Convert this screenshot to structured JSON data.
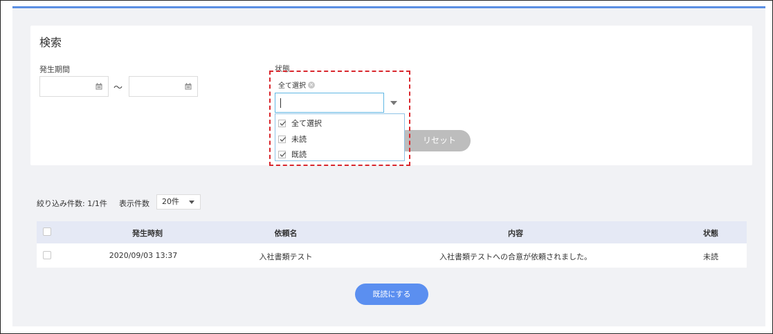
{
  "search": {
    "title": "検索",
    "period_label": "発生期間",
    "tilde": "～",
    "status_label": "状態",
    "status_chip": "全て選択",
    "options": [
      {
        "label": "全て選択",
        "checked": true
      },
      {
        "label": "未読",
        "checked": true
      },
      {
        "label": "既読",
        "checked": true
      }
    ],
    "reset_label": "リセット"
  },
  "list": {
    "summary": "絞り込み件数: 1/1件",
    "per_page_label": "表示件数",
    "per_page_value": "20件",
    "headers": [
      "発生時刻",
      "依頼名",
      "内容",
      "状態"
    ],
    "rows": [
      {
        "time": "2020/09/03 13:37",
        "name": "入社書類テスト",
        "content": "入社書類テストへの合意が依頼されました。",
        "status": "未読"
      }
    ],
    "mark_read_label": "既読にする"
  },
  "colors": {
    "accent": "#5b8ff0",
    "highlight": "#d9262c",
    "header_bg": "#e5e9f5"
  }
}
